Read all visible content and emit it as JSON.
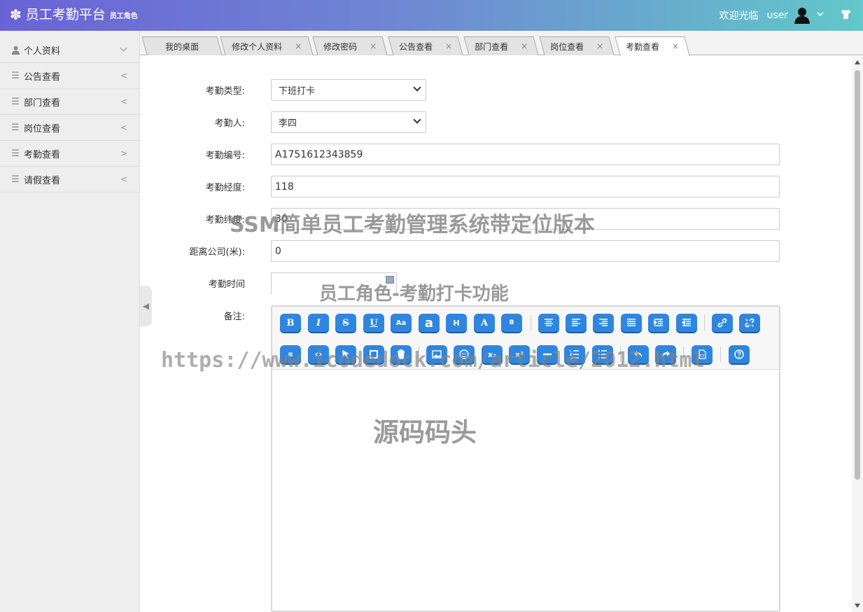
{
  "header": {
    "app_title": "员工考勤平台",
    "role_label": "员工角色",
    "welcome": "欢迎光临",
    "username": "user"
  },
  "sidebar": {
    "items": [
      {
        "label": "个人资料",
        "icon": "user-icon",
        "arrow": "⌵"
      },
      {
        "label": "公告查看",
        "icon": "menu-icon",
        "arrow": "<"
      },
      {
        "label": "部门查看",
        "icon": "menu-icon",
        "arrow": "<"
      },
      {
        "label": "岗位查看",
        "icon": "menu-icon",
        "arrow": "<"
      },
      {
        "label": "考勤查看",
        "icon": "menu-icon",
        "arrow": ">"
      },
      {
        "label": "请假查看",
        "icon": "menu-icon",
        "arrow": "<"
      }
    ]
  },
  "tabs": [
    {
      "label": "我的桌面",
      "closable": false
    },
    {
      "label": "修改个人资料",
      "closable": true
    },
    {
      "label": "修改密码",
      "closable": true
    },
    {
      "label": "公告查看",
      "closable": true
    },
    {
      "label": "部门查看",
      "closable": true
    },
    {
      "label": "岗位查看",
      "closable": true
    },
    {
      "label": "考勤查看",
      "closable": true,
      "active": true
    }
  ],
  "close_symbol": "×",
  "form": {
    "type_label": "考勤类型:",
    "type_value": "下班打卡",
    "person_label": "考勤人:",
    "person_value": "李四",
    "code_label": "考勤编号:",
    "code_value": "A1751612343859",
    "lng_label": "考勤经度:",
    "lng_value": "118",
    "lat_label": "考勤纬度:",
    "lat_value": "30",
    "distance_label": "距离公司(米):",
    "distance_value": "0",
    "time_label": "考勤时间",
    "time_value": "",
    "remark_label": "备注:"
  },
  "watermarks": {
    "title": "SSM简单员工考勤管理系统带定位版本",
    "subtitle": "员工角色-考勤打卡功能",
    "url": "https://www.icodedock.com/article/2012.html",
    "brand": "源码码头"
  },
  "colors": {
    "accent": "#2f86de",
    "header_start": "#6a63d6",
    "header_end": "#62c8c9"
  }
}
